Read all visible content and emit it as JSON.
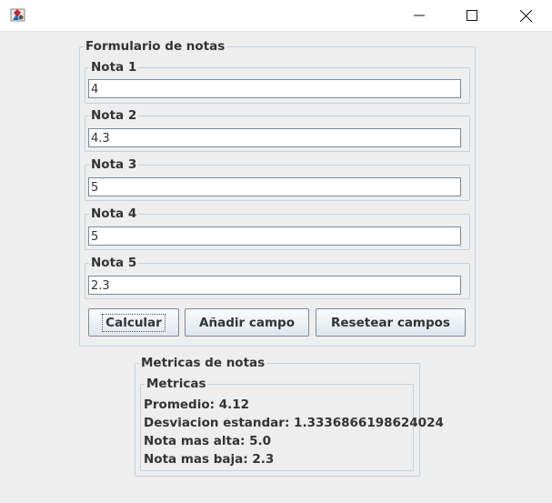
{
  "window": {
    "icon": "java-cup-icon",
    "controls": {
      "minimize": "minimize-icon",
      "maximize": "maximize-icon",
      "close": "close-icon"
    }
  },
  "form": {
    "title": "Formulario de notas",
    "fields": [
      {
        "label": "Nota 1",
        "value": "4"
      },
      {
        "label": "Nota 2",
        "value": "4.3"
      },
      {
        "label": "Nota 3",
        "value": "5"
      },
      {
        "label": "Nota 4",
        "value": "5"
      },
      {
        "label": "Nota 5",
        "value": "2.3"
      }
    ],
    "buttons": {
      "calculate": "Calcular",
      "add_field": "Añadir campo",
      "reset": "Resetear campos"
    }
  },
  "metrics": {
    "title": "Metricas de notas",
    "group_title": "Metricas",
    "average": "Promedio: 4.12",
    "std_dev": "Desviacion estandar: 1.3336866198624024",
    "max": "Nota mas alta: 5.0",
    "min": "Nota mas baja: 2.3"
  }
}
